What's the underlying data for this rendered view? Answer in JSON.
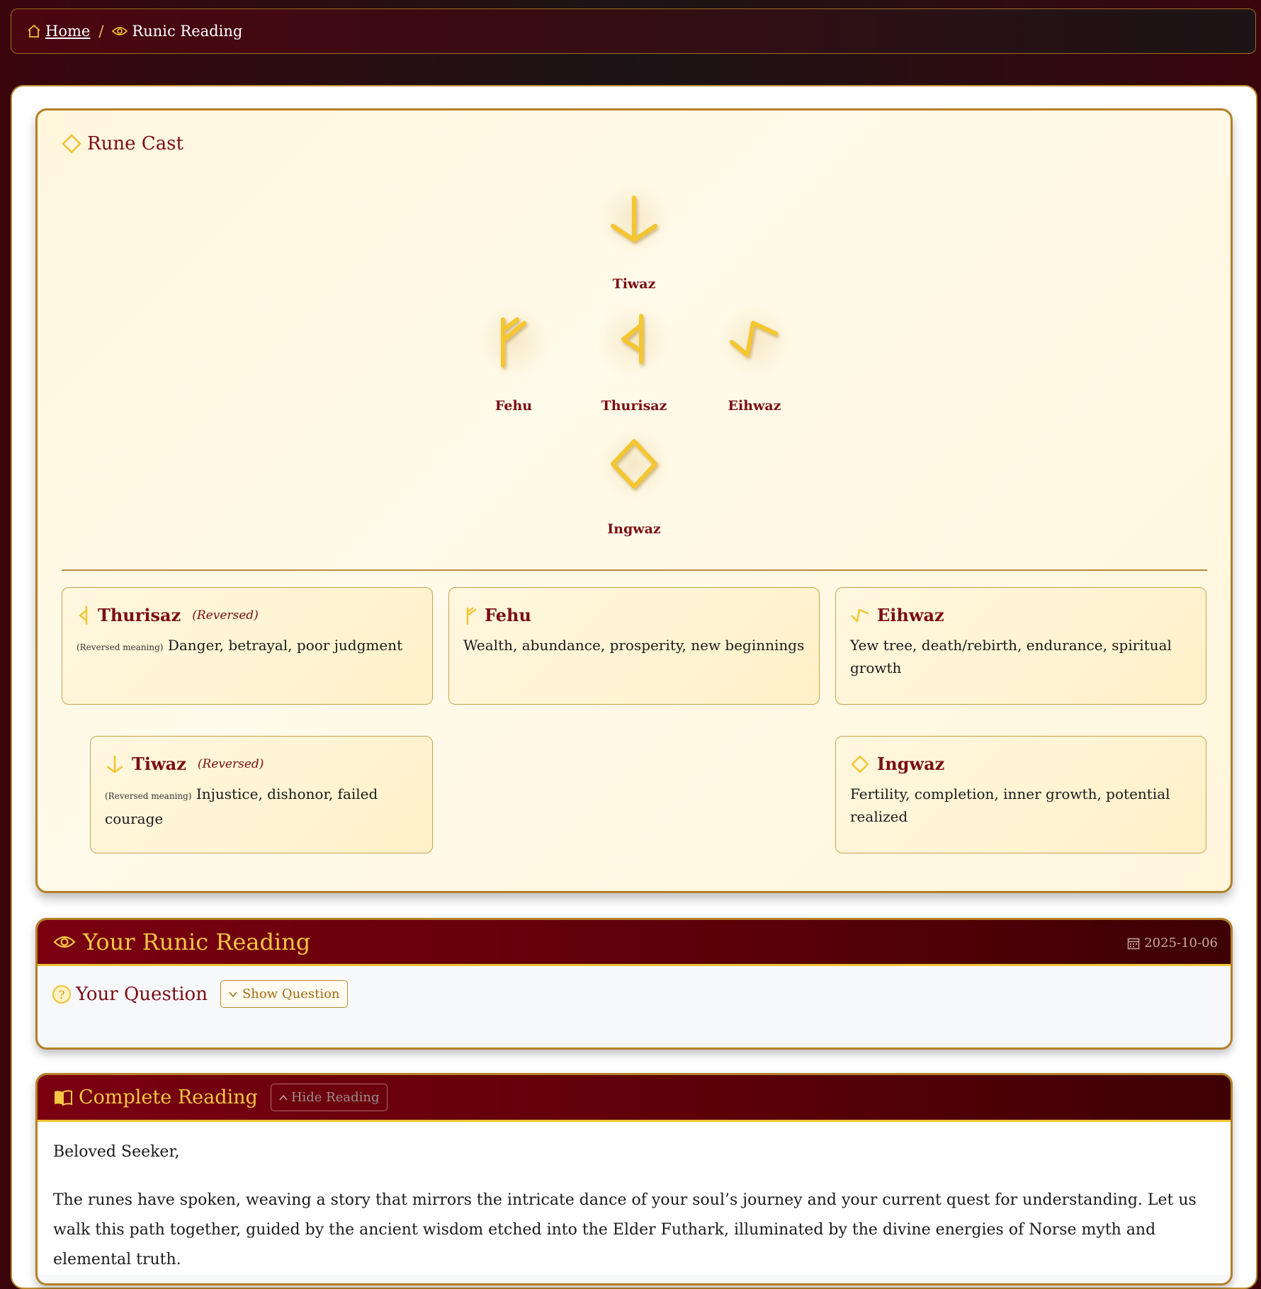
{
  "breadcrumb": {
    "home_label": " Home",
    "separator": "/",
    "current_label": "Runic Reading"
  },
  "rune_cast": {
    "title": "Rune Cast",
    "runes": [
      {
        "name": "Tiwaz",
        "position": "top",
        "reversed": true
      },
      {
        "name": "Fehu",
        "position": "left",
        "reversed": false
      },
      {
        "name": "Thurisaz",
        "position": "center",
        "reversed": true
      },
      {
        "name": "Eihwaz",
        "position": "right",
        "reversed": false
      },
      {
        "name": "Ingwaz",
        "position": "bottom",
        "reversed": false
      }
    ]
  },
  "meanings": [
    {
      "name": "Thurisaz",
      "reversed_tag": "(Reversed)",
      "reversed_label": "(Reversed meaning)",
      "text": "Danger, betrayal, poor judgment"
    },
    {
      "name": "Fehu",
      "text": "Wealth, abundance, prosperity, new beginnings"
    },
    {
      "name": "Eihwaz",
      "text": "Yew tree, death/rebirth, endurance, spiritual growth"
    },
    {
      "name": "Tiwaz",
      "reversed_tag": "(Reversed)",
      "reversed_label": "(Reversed meaning)",
      "text": "Injustice, dishonor, failed courage"
    },
    {
      "name": "Ingwaz",
      "text": "Fertility, completion, inner growth, potential realized"
    }
  ],
  "reading": {
    "title": "Your Runic Reading",
    "date": "2025-10-06",
    "question_title": "Your Question",
    "show_question_label": "Show Question"
  },
  "complete_reading": {
    "title": "Complete Reading",
    "hide_label": "Hide Reading",
    "greeting": "Beloved Seeker,",
    "paragraph": "The runes have spoken, weaving a story that mirrors the intricate dance of your soul’s journey and your current quest for understanding. Let us walk this path together, guided by the ancient wisdom etched into the Elder Futhark, illuminated by the divine energies of Norse myth and elemental truth."
  },
  "colors": {
    "gold": "#f6c744",
    "maroon": "#7a0d14",
    "border_gold": "#b57f26"
  }
}
